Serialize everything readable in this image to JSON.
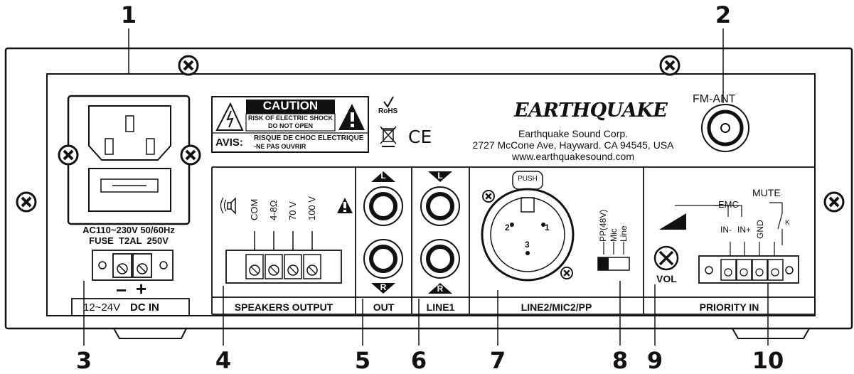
{
  "callouts": [
    "1",
    "2",
    "3",
    "4",
    "5",
    "6",
    "7",
    "8",
    "9",
    "10"
  ],
  "caution": {
    "title": "CAUTION",
    "line1": "RISK OF ELECTRIC SHOCK",
    "line2": "DO NOT OPEN",
    "avis": "AVIS:",
    "avis_line1": "RISQUE DE CHOC ELECTRIQUE",
    "avis_line2": "-NE PAS OUVRIR"
  },
  "rohs": "RoHS",
  "ce": "CE",
  "brand": {
    "logo": "EARTHQUAKE",
    "company": "Earthquake Sound Corp.",
    "address": "2727 McCone Ave, Hayward. CA 94545, USA",
    "website": "www.earthquakesound.com"
  },
  "antenna": {
    "label": "FM-ANT"
  },
  "power": {
    "rating": "AC110~230V 50/60Hz",
    "fuse": "FUSE  T2AL  250V",
    "minus": "−",
    "plus": "+",
    "dc_range": "12~24V",
    "dc_label": "DC IN"
  },
  "speakers": {
    "terminals": [
      "COM",
      "4-8Ω",
      "70 V",
      "100 V"
    ],
    "label": "SPEAKERS OUTPUT"
  },
  "out": {
    "top": "L",
    "bottom": "R",
    "label": "OUT"
  },
  "line1": {
    "top": "L",
    "bottom": "R",
    "label": "LINE1"
  },
  "xlr": {
    "push": "PUSH",
    "pins": [
      "2",
      "1",
      "3"
    ],
    "switch_options": [
      "PP(48V)",
      "Mic",
      "Line"
    ],
    "label": "LINE2/MIC2/PP"
  },
  "priority": {
    "emc": "EMC",
    "mute": "MUTE",
    "in_minus": "IN-",
    "in_plus": "IN+",
    "gnd": "GND",
    "k": "K",
    "vol": "VOL",
    "label": "PRIORITY IN"
  }
}
